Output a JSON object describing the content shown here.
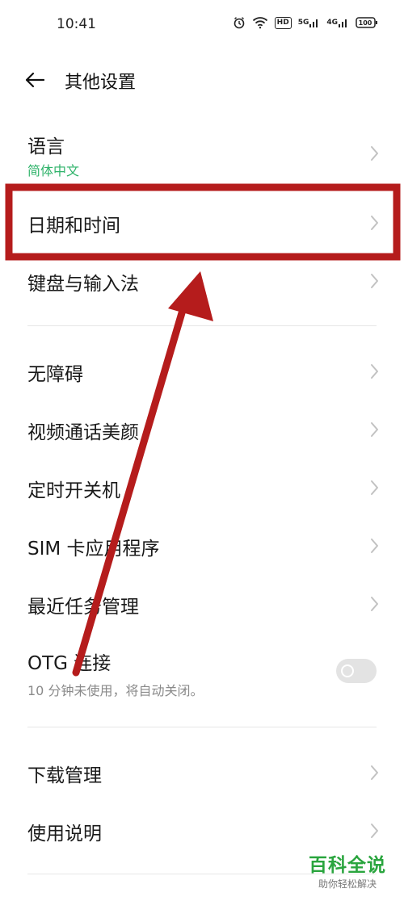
{
  "status": {
    "time": "10:41",
    "icons": [
      "alarm-icon",
      "wifi-icon",
      "hd-icon",
      "signal-5g-icon",
      "signal-4g-icon",
      "battery-icon"
    ],
    "hd": "HD",
    "net1": "5G",
    "net2": "4G",
    "battery": "100"
  },
  "header": {
    "title": "其他设置"
  },
  "items": [
    {
      "label": "语言",
      "sub": "简体中文"
    },
    {
      "label": "日期和时间"
    },
    {
      "label": "键盘与输入法"
    },
    {
      "label": "无障碍"
    },
    {
      "label": "视频通话美颜"
    },
    {
      "label": "定时开关机"
    },
    {
      "label": "SIM 卡应用程序"
    },
    {
      "label": "最近任务管理"
    },
    {
      "label": "OTG 连接",
      "sub": "10 分钟未使用，将自动关闭。",
      "toggle": false
    },
    {
      "label": "下载管理"
    },
    {
      "label": "使用说明"
    }
  ],
  "watermark": {
    "title": "百科全说",
    "subtitle": "助你轻松解决"
  },
  "colors": {
    "accent": "#2fb36a",
    "annotation": "#b51c1c",
    "watermark": "#2aa53e"
  }
}
